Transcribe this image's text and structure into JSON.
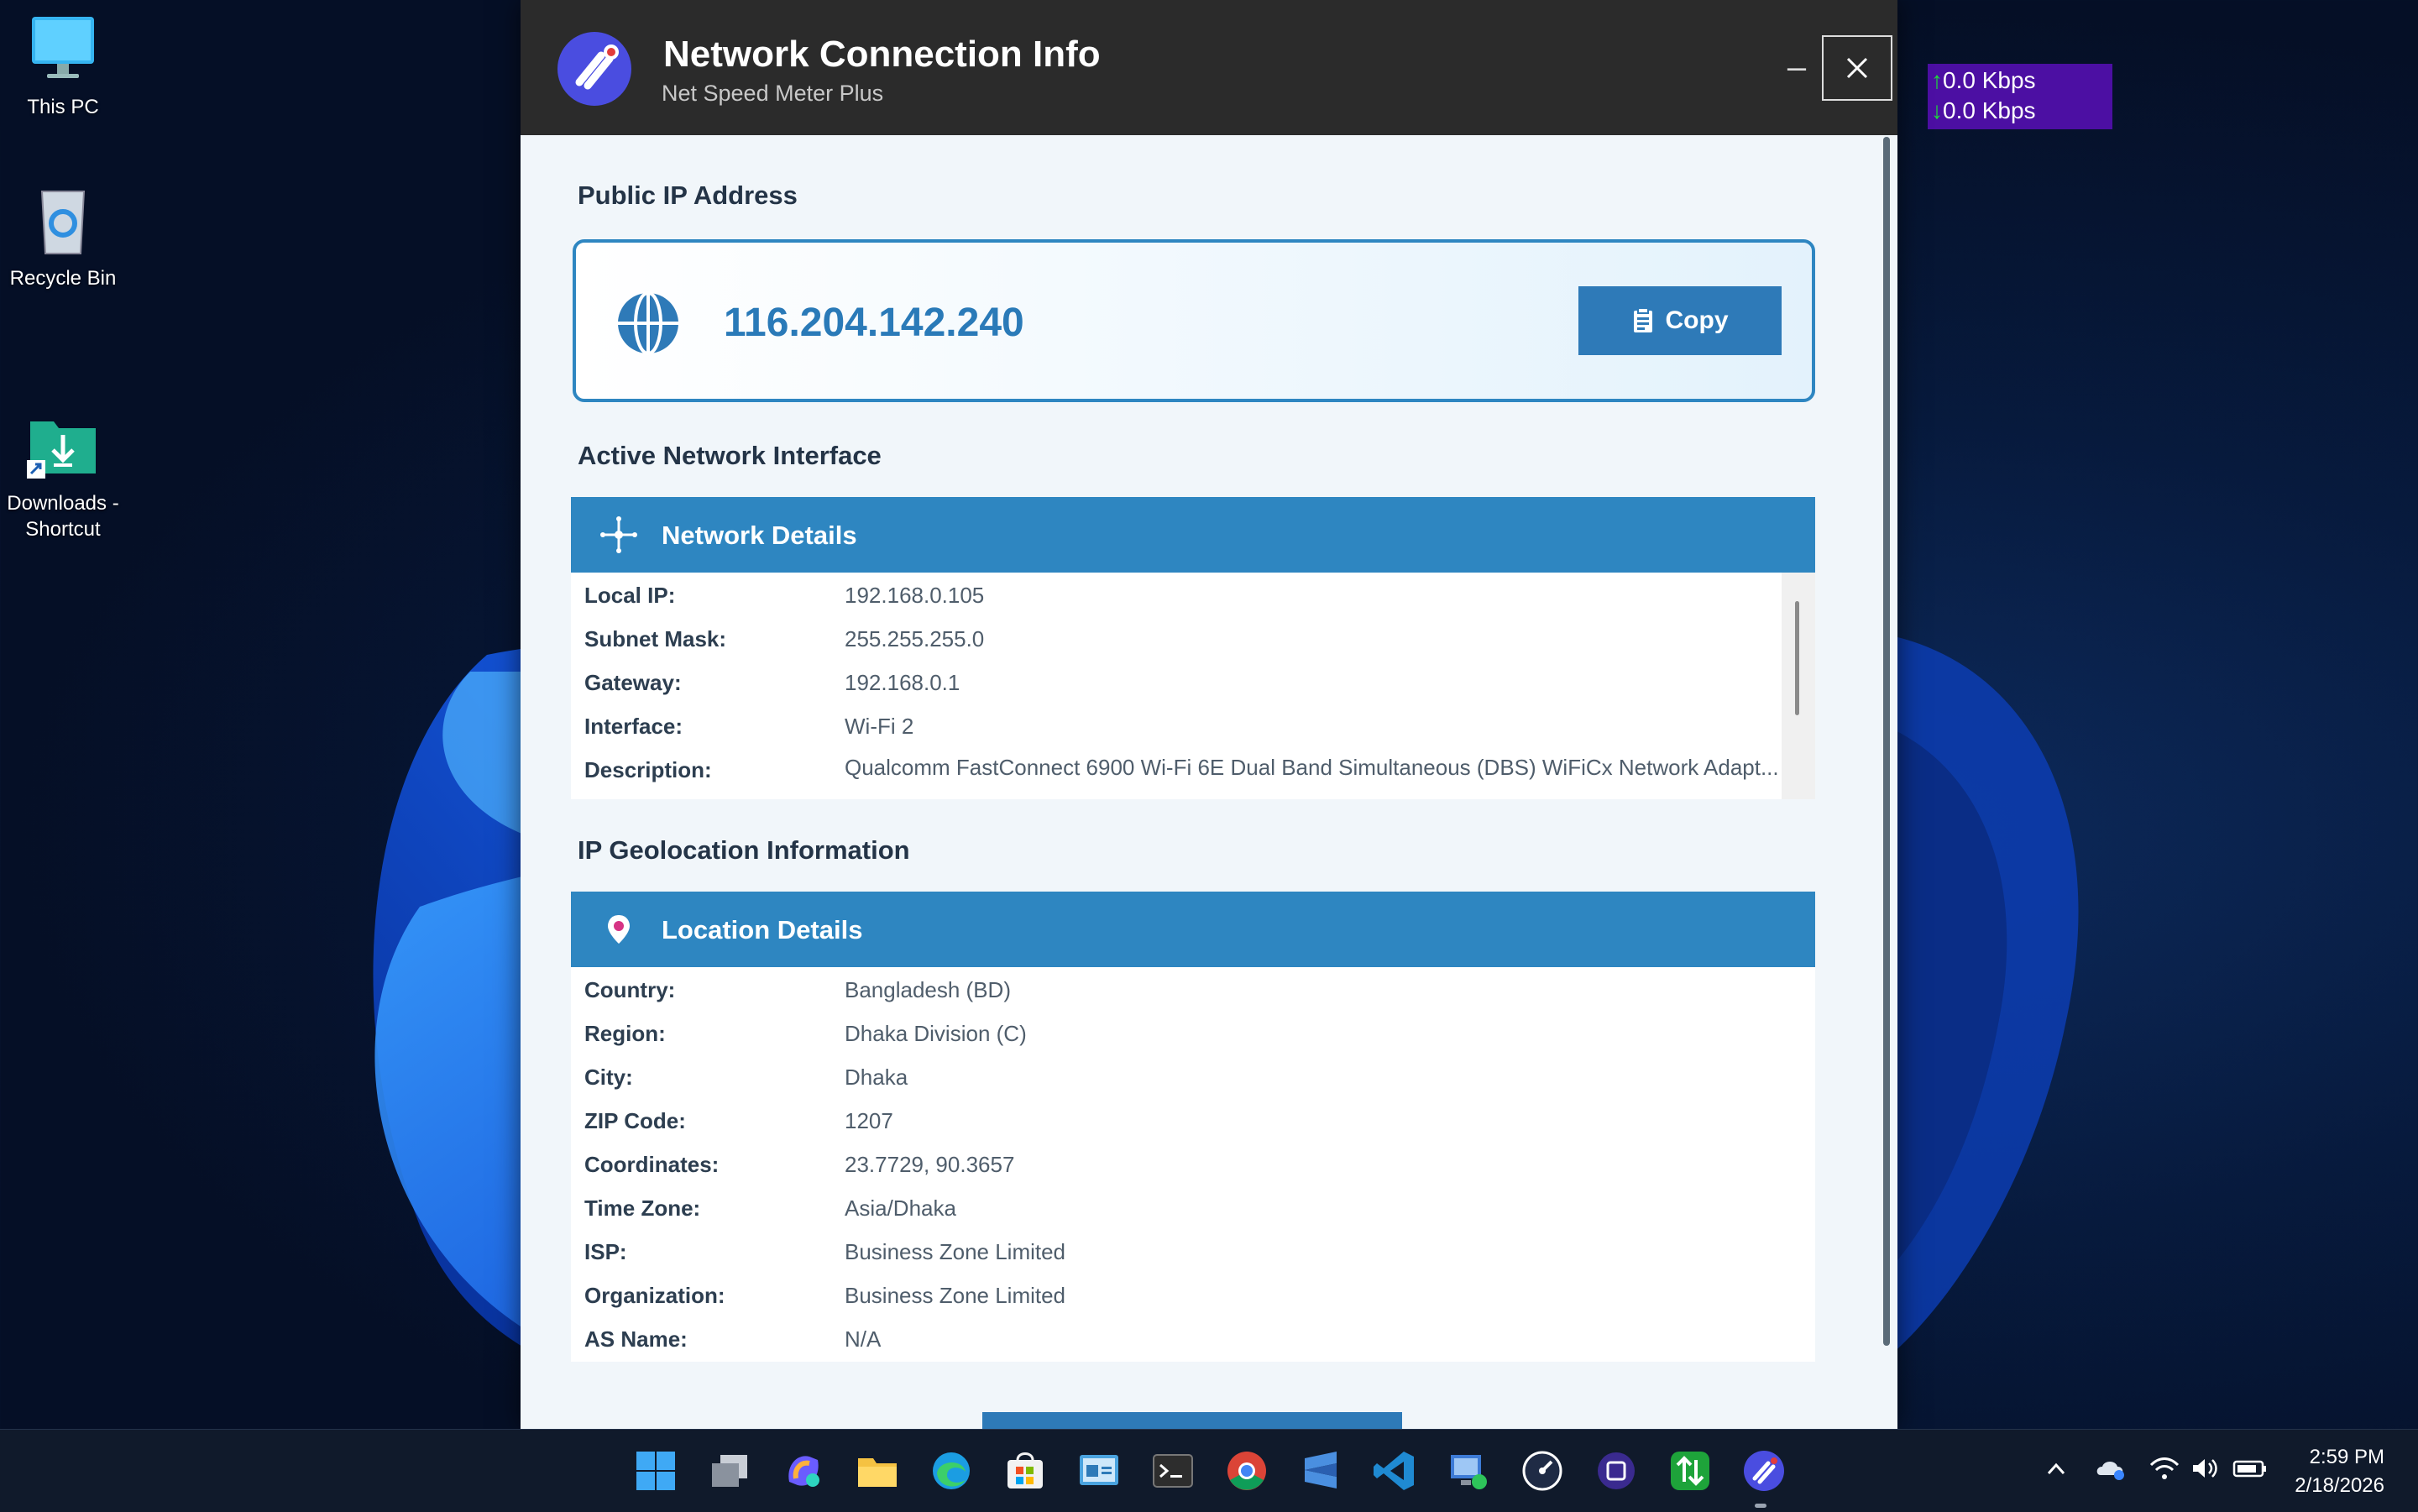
{
  "desktop": {
    "icons": [
      {
        "label": "This PC"
      },
      {
        "label": "Recycle Bin"
      },
      {
        "label": "Downloads -\nShortcut"
      }
    ]
  },
  "window": {
    "title": "Network Connection Info",
    "subtitle": "Net Speed Meter Plus",
    "minimize_glyph": "–",
    "close_icon": "close-icon"
  },
  "public_ip": {
    "section_title": "Public IP Address",
    "value": "116.204.142.240",
    "copy_label": "Copy"
  },
  "network": {
    "section_title": "Active Network Interface",
    "panel_title": "Network Details",
    "rows": [
      {
        "key": "Local IP:",
        "value": "192.168.0.105"
      },
      {
        "key": "Subnet Mask:",
        "value": "255.255.255.0"
      },
      {
        "key": "Gateway:",
        "value": "192.168.0.1"
      },
      {
        "key": "Interface:",
        "value": "Wi-Fi 2"
      },
      {
        "key": "Description:",
        "value": "Qualcomm FastConnect 6900 Wi-Fi 6E Dual Band Simultaneous (DBS) WiFiCx Network Adapt..."
      }
    ]
  },
  "geo": {
    "section_title": "IP Geolocation Information",
    "panel_title": "Location Details",
    "rows": [
      {
        "key": "Country:",
        "value": "Bangladesh (BD)"
      },
      {
        "key": "Region:",
        "value": "Dhaka Division (C)"
      },
      {
        "key": "City:",
        "value": "Dhaka"
      },
      {
        "key": "ZIP Code:",
        "value": "1207"
      },
      {
        "key": "Coordinates:",
        "value": "23.7729, 90.3657"
      },
      {
        "key": "Time Zone:",
        "value": "Asia/Dhaka"
      },
      {
        "key": "ISP:",
        "value": "Business Zone Limited"
      },
      {
        "key": "Organization:",
        "value": "Business Zone Limited"
      },
      {
        "key": "AS Name:",
        "value": "N/A"
      }
    ]
  },
  "speed_meter": {
    "upload": "0.0 Kbps",
    "download": "0.0 Kbps",
    "background": "#4c0fa3"
  },
  "taskbar": {
    "apps": [
      "start-icon",
      "task-view-icon",
      "copilot-icon",
      "file-explorer-icon",
      "edge-icon",
      "store-icon",
      "control-panel-icon",
      "terminal-icon",
      "chrome-icon",
      "sublime-icon",
      "vscode-icon",
      "remote-desktop-icon",
      "speedometer-icon",
      "app-icon",
      "transfer-icon",
      "net-speed-meter-icon"
    ],
    "time": "2:59 PM",
    "date": "2/18/2026"
  },
  "colors": {
    "accent": "#2e86c1",
    "ip_text": "#2a7ab8",
    "titlebar": "#2b2b2b"
  }
}
